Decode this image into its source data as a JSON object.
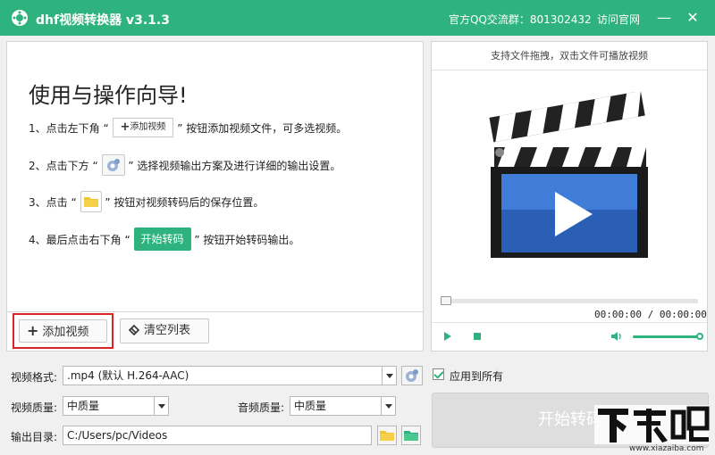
{
  "titlebar": {
    "app_title": "dhf视频转换器 v3.1.3",
    "qq_group": "官方QQ交流群：801302432",
    "visit_site": "访问官网",
    "minimize": "—",
    "close": "✕",
    "accent_color": "#2fb37e"
  },
  "guide": {
    "title": "使用与操作向导!",
    "step1_prefix": "1、点击左下角 “",
    "step1_button": "添加视频",
    "step1_suffix": "” 按钮添加视频文件，可多选视频。",
    "step2_prefix": "2、点击下方 “",
    "step2_suffix": "” 选择视频输出方案及进行详细的输出设置。",
    "step3_prefix": "3、点击 “",
    "step3_suffix": "” 按钮对视频转码后的保存位置。",
    "step4_prefix": "4、最后点击右下角 “",
    "step4_button": "开始转码",
    "step4_suffix": "” 按钮开始转码输出。"
  },
  "list_buttons": {
    "add_video": "添加视频",
    "clear_list": "清空列表"
  },
  "player": {
    "hint": "支持文件拖拽，双击文件可播放视频",
    "time": "00:00:00 / 00:00:00",
    "progress": 0,
    "volume": 1.0
  },
  "settings": {
    "format_label": "视频格式:",
    "format_value": ".mp4 (默认 H.264-AAC)",
    "apply_all_label": "应用到所有",
    "apply_all_checked": true,
    "video_quality_label": "视频质量:",
    "video_quality_value": "中质量",
    "audio_quality_label": "音频质量:",
    "audio_quality_value": "中质量",
    "output_label": "输出目录:",
    "output_path": "C:/Users/pc/Videos"
  },
  "start_button": {
    "label": "开始转码"
  },
  "watermark": {
    "url": "www.xiazaiba.com"
  }
}
